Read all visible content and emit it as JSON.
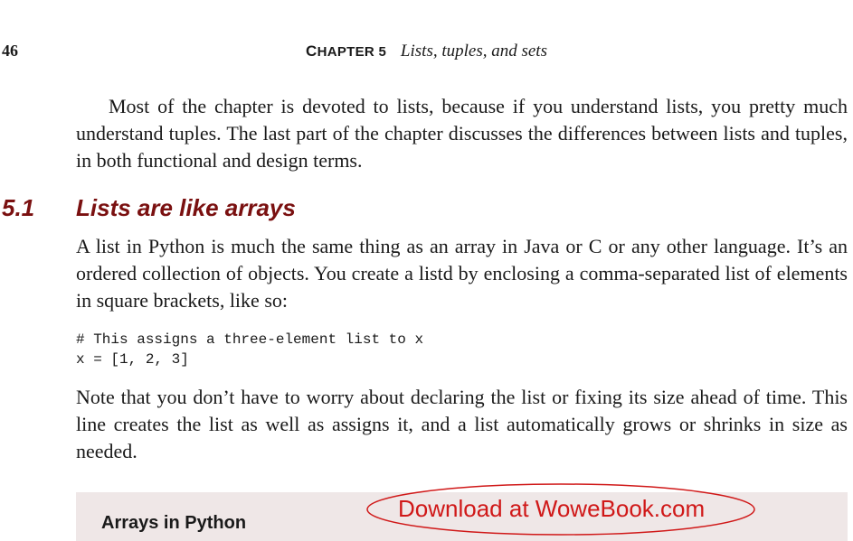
{
  "header": {
    "page_number": "46",
    "chapter_label_cap": "C",
    "chapter_label_rest": "HAPTER 5",
    "chapter_title": "Lists, tuples, and sets"
  },
  "intro_paragraph": "Most of the chapter is devoted to lists, because if you understand lists, you pretty much understand tuples. The last part of the chapter discusses the differences between lists and tuples, in both functional and design terms.",
  "section": {
    "number": "5.1",
    "title": "Lists are like arrays"
  },
  "paragraph_1": "A list in Python is much the same thing as an array in Java or C or any other language. It’s an ordered collection of objects. You create a listd by enclosing a comma-separated list of elements in square brackets, like so:",
  "code": {
    "line_1": "# This assigns a three-element list to x",
    "line_2": "x = [1, 2, 3]"
  },
  "paragraph_2": "Note that you don’t have to worry about declaring the list or fixing its size ahead of time. This line creates the list as well as assigns it, and a list automatically grows or shrinks in size as needed.",
  "sidebar": {
    "title": "Arrays in Python"
  },
  "watermark": {
    "text": "Download at WoweBook.com",
    "color": "#d01818"
  }
}
